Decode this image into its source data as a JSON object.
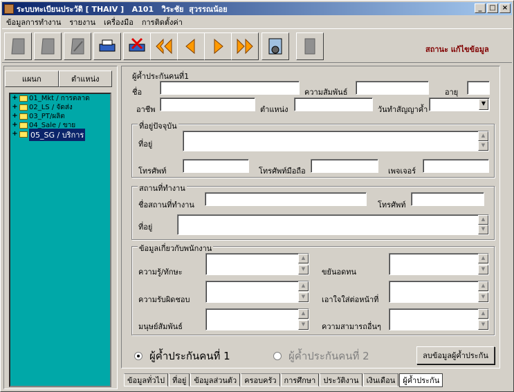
{
  "window": {
    "title": "ระบบทะเบียนประวัติ [ THAIV ]   A101   วิระชัย  สุวรรณน้อย",
    "min": "_",
    "max": "□",
    "close": "×"
  },
  "menu": [
    "ข้อมูลการทำงาน",
    "รายงาน",
    "เครื่องมือ",
    "การติดตั้งค่า"
  ],
  "status": "สถานะ แก้ไขข้อมูล",
  "left_tabs": [
    "แผนก",
    "ตำแหน่ง"
  ],
  "tree": [
    {
      "plus": "+",
      "label": "01_Mkt / การตลาด"
    },
    {
      "plus": "+",
      "label": "02_LS / จัดส่ง"
    },
    {
      "plus": "+",
      "label": "03_PT/ผลิต"
    },
    {
      "plus": "+",
      "label": "04_Sale / ขาย"
    },
    {
      "plus": "+",
      "label": "05_SG / บริการ"
    }
  ],
  "guarantor": {
    "title": "ผู้ค้ำประกันคนที่1",
    "name": "ชื่อ",
    "relation": "ความสัมพันธ์",
    "age": "อายุ",
    "occupation": "อาชีพ",
    "position": "ตำแหน่ง",
    "contract_date": "วันทำสัญญาค้ำ",
    "dropdown": "▼"
  },
  "current_address": {
    "title": "ที่อยู่ปัจจุบัน",
    "address": "ที่อยู่",
    "phone": "โทรศัพท์",
    "mobile": "โทรศัพท์มือถือ",
    "pager": "เพจเจอร์"
  },
  "workplace": {
    "title": "สถานที่ทำงาน",
    "name": "ชื่อสถานที่ทำงาน",
    "phone": "โทรศัพท์",
    "address": "ที่อยู่"
  },
  "employee_info": {
    "title": "ข้อมูลเกี่ยวกับพนักงาน",
    "knowledge": "ความรู้/ทักษะ",
    "diligence": "ขยันอดทน",
    "responsibility": "ความรับผิดชอบ",
    "attention": "เอาใจใส่ต่อหน้าที่",
    "relations": "มนุษย์สัมพันธ์",
    "other": "ความสามารถอื่นๆ"
  },
  "radios": {
    "g1": "ผู้ค้ำประกันคนที่ 1",
    "g2": "ผู้ค้ำประกันคนที่ 2"
  },
  "delete_button": "ลบข้อมูลผู้ค้ำประกัน",
  "tabs": [
    "ข้อมูลทั่วไป",
    "ที่อยู่",
    "ข้อมูลส่วนตัว",
    "ครอบครัว",
    "การศึกษา",
    "ประวัติงาน",
    "เงินเดือน",
    "ผู้ค้ำประกัน"
  ]
}
